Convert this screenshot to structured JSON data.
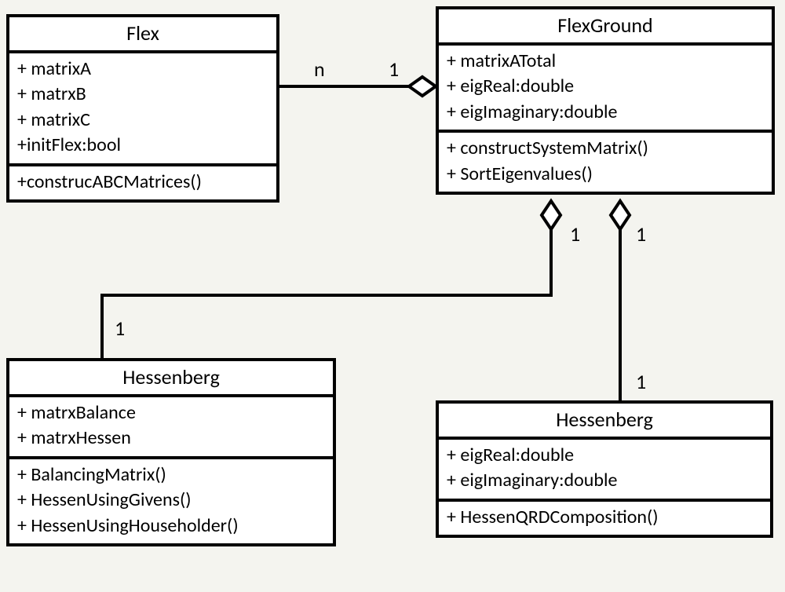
{
  "classes": {
    "flex": {
      "name": "Flex",
      "attrs": [
        "+ matrixA",
        "+ matrxB",
        "+ matrixC",
        "+initFlex:bool"
      ],
      "ops": [
        "+construcABCMatrices()"
      ]
    },
    "flexGround": {
      "name": "FlexGround",
      "attrs": [
        "+ matrixATotal",
        "+ eigReal:double",
        "+ eigImaginary:double"
      ],
      "ops": [
        "+ constructSystemMatrix()",
        "+ SortEigenvalues()"
      ]
    },
    "hess1": {
      "name": "Hessenberg",
      "attrs": [
        "+ matrxBalance",
        "+ matrxHessen"
      ],
      "ops": [
        "+ BalancingMatrix()",
        "+ HessenUsingGivens()",
        "+ HessenUsingHouseholder()"
      ]
    },
    "hess2": {
      "name": "Hessenberg",
      "attrs": [
        "+ eigReal:double",
        "+ eigImaginary:double"
      ],
      "ops": [
        "+ HessenQRDComposition()"
      ]
    }
  },
  "mult": {
    "flex_flexground_n": "n",
    "flex_flexground_1": "1",
    "flexground_hess1_top_1": "1",
    "flexground_hess1_bottom_1": "1",
    "flexground_hess2_top_1": "1",
    "flexground_hess2_bottom_1": "1"
  }
}
